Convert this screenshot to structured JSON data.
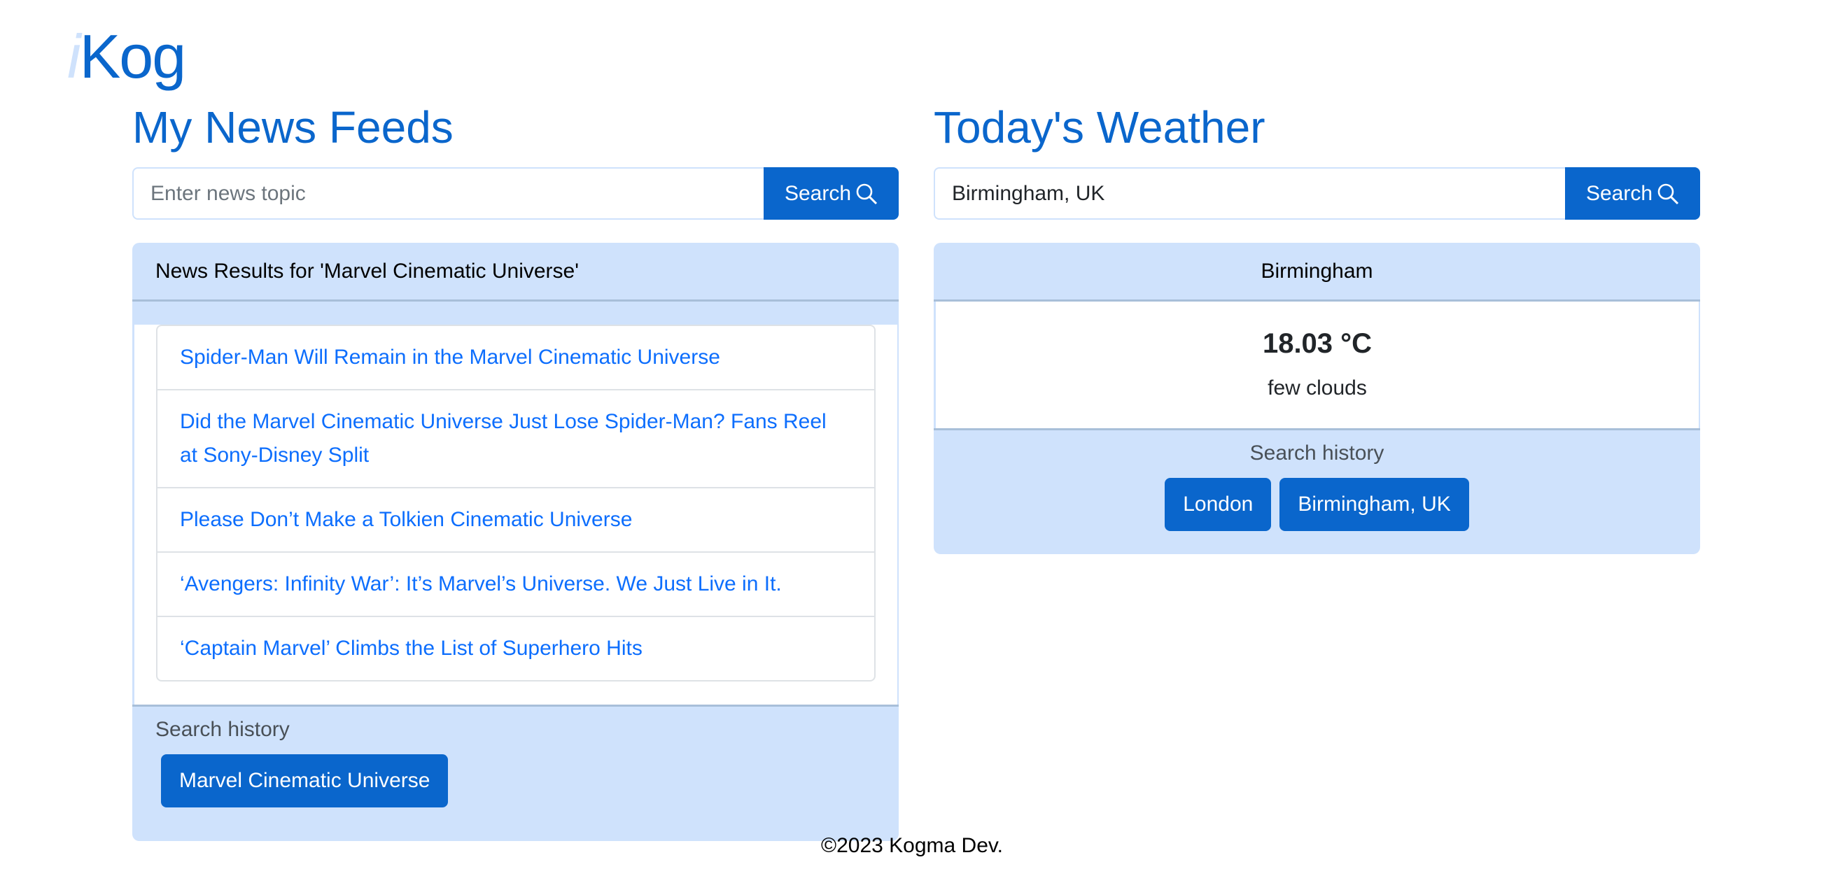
{
  "logo": {
    "prefix": "i",
    "name": "Kog"
  },
  "news": {
    "title": "My News Feeds",
    "search": {
      "placeholder": "Enter news topic",
      "value": "",
      "button": "Search"
    },
    "results_header": "News Results for 'Marvel Cinematic Universe'",
    "articles": [
      "Spider-Man Will Remain in the Marvel Cinematic Universe",
      "Did the Marvel Cinematic Universe Just Lose Spider-Man? Fans Reel at Sony-Disney Split",
      "Please Don’t Make a Tolkien Cinematic Universe",
      "‘Avengers: Infinity War’: It’s Marvel’s Universe. We Just Live in It.",
      "‘Captain Marvel’ Climbs the List of Superhero Hits"
    ],
    "history_label": "Search history",
    "history": [
      "Marvel Cinematic Universe"
    ]
  },
  "weather": {
    "title": "Today's Weather",
    "search": {
      "placeholder": "",
      "value": "Birmingham, UK",
      "button": "Search"
    },
    "city": "Birmingham",
    "temperature": "18.03 °C",
    "description": "few clouds",
    "history_label": "Search history",
    "history": [
      "London",
      "Birmingham, UK"
    ]
  },
  "footer": "©2023 Kogma Dev.",
  "colors": {
    "primary": "#0a66cc",
    "light": "#cfe2fc",
    "link": "#0d6efd"
  }
}
